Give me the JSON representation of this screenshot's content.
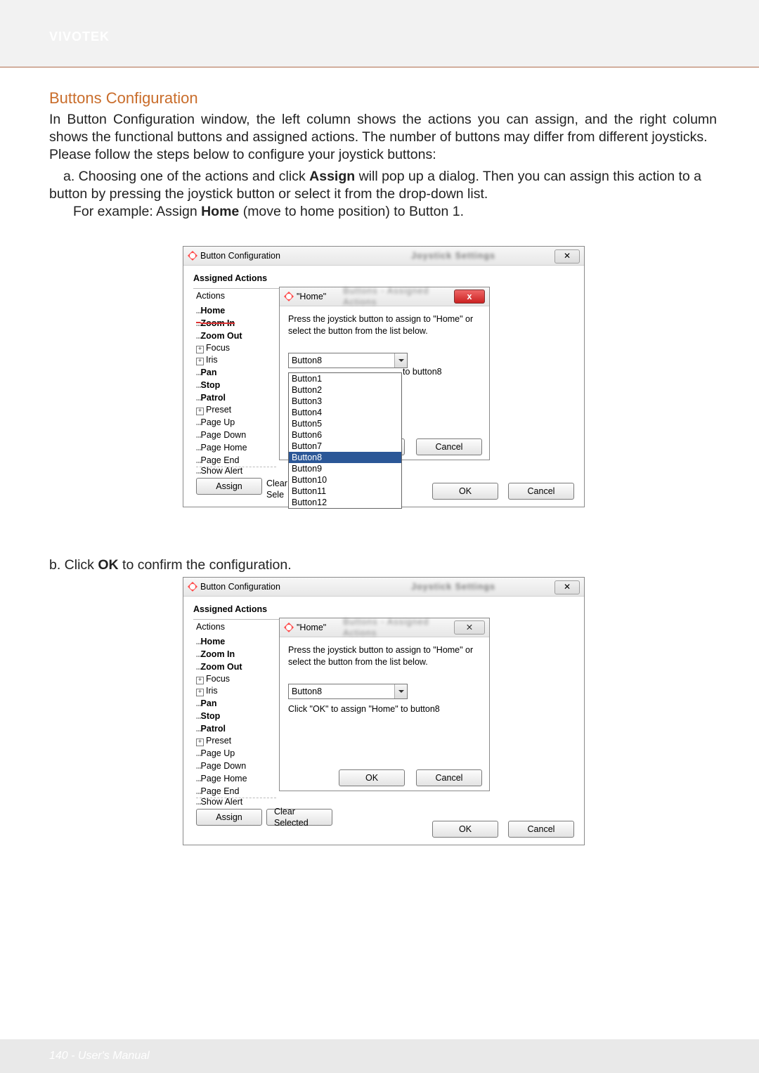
{
  "header": {
    "brand": "VIVOTEK"
  },
  "section": {
    "title": "Buttons Configuration",
    "intro": "In Button Configuration window, the left column shows the actions you can assign, and the right column shows the functional buttons and assigned actions. The number of buttons may differ from different joysticks.",
    "lead": "Please follow the steps below to configure your joystick buttons:",
    "step_a_1": "a. Choosing one of the actions and click ",
    "step_a_assign": "Assign",
    "step_a_2": " will pop up a dialog. Then you can assign this action to a button by pressing the joystick button or select it from the drop-down list.",
    "step_a_3a": "For example: Assign ",
    "step_a_home": "Home",
    "step_a_3b": " (move to home position) to Button 1.",
    "step_b_1": "b. Click ",
    "step_b_ok": "OK",
    "step_b_2": " to confirm the configuration."
  },
  "win": {
    "title": "Button Configuration",
    "blur": "Joystick Settings",
    "close_glyph": "✕",
    "group": "Assigned Actions",
    "actions_header": "Actions",
    "tree": [
      {
        "prefix": "…",
        "label": "Home",
        "bold": true
      },
      {
        "prefix": "…",
        "label": "Zoom In",
        "bold": true,
        "strike_top": true
      },
      {
        "prefix": "…",
        "label": "Zoom Out",
        "bold": true
      },
      {
        "prefix": "",
        "expander": "+",
        "label": "Focus"
      },
      {
        "prefix": "",
        "expander": "+",
        "label": "Iris"
      },
      {
        "prefix": "…",
        "label": "Pan",
        "bold": true
      },
      {
        "prefix": "…",
        "label": "Stop",
        "bold": true
      },
      {
        "prefix": "…",
        "label": "Patrol",
        "bold": true
      },
      {
        "prefix": "",
        "expander": "+",
        "label": "Preset"
      },
      {
        "prefix": "…",
        "label": "Page Up"
      },
      {
        "prefix": "…",
        "label": "Page Down"
      },
      {
        "prefix": "…",
        "label": "Page Home"
      },
      {
        "prefix": "…",
        "label": "Page End"
      }
    ],
    "tree_cutoff": "Show Alert",
    "assign_btn": "Assign",
    "clear_btn": "Clear Selected",
    "clear_btn_clipped": "Clear Sele",
    "ok": "OK",
    "cancel": "Cancel"
  },
  "dlg1": {
    "title": "\"Home\"",
    "msg": "Press the joystick button to assign to \"Home\" or select the button from the list below.",
    "selected": "Button8",
    "side_note": "to button8",
    "options": [
      "Button1",
      "Button2",
      "Button3",
      "Button4",
      "Button5",
      "Button6",
      "Button7",
      "Button8",
      "Button9",
      "Button10",
      "Button11",
      "Button12"
    ],
    "selected_index": 7,
    "ok": "OK",
    "cancel": "Cancel"
  },
  "dlg2": {
    "title": "\"Home\"",
    "msg": "Press the joystick button to assign to \"Home\" or select the button from the list below.",
    "selected": "Button8",
    "hint": "Click \"OK\" to assign \"Home\" to button8",
    "ok": "OK",
    "cancel": "Cancel"
  },
  "footer": {
    "text": "140 - User's Manual"
  }
}
